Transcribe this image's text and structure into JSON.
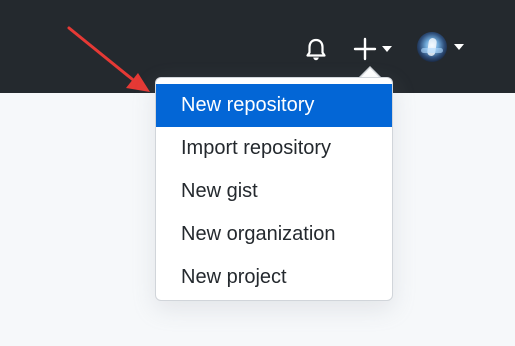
{
  "header": {
    "notifications_icon": "bell-icon",
    "create_icon": "plus-icon",
    "create_caret_icon": "caret-down-icon",
    "avatar_caret_icon": "caret-down-icon"
  },
  "annotation": {
    "arrow_color": "#e53935"
  },
  "dropdown": {
    "items": [
      {
        "label": "New repository",
        "active": true
      },
      {
        "label": "Import repository",
        "active": false
      },
      {
        "label": "New gist",
        "active": false
      },
      {
        "label": "New organization",
        "active": false
      },
      {
        "label": "New project",
        "active": false
      }
    ]
  },
  "colors": {
    "header_bg": "#24292e",
    "page_bg": "#f6f8fa",
    "active_item_bg": "#0366d6",
    "active_item_text": "#ffffff",
    "item_text": "#24292e"
  }
}
